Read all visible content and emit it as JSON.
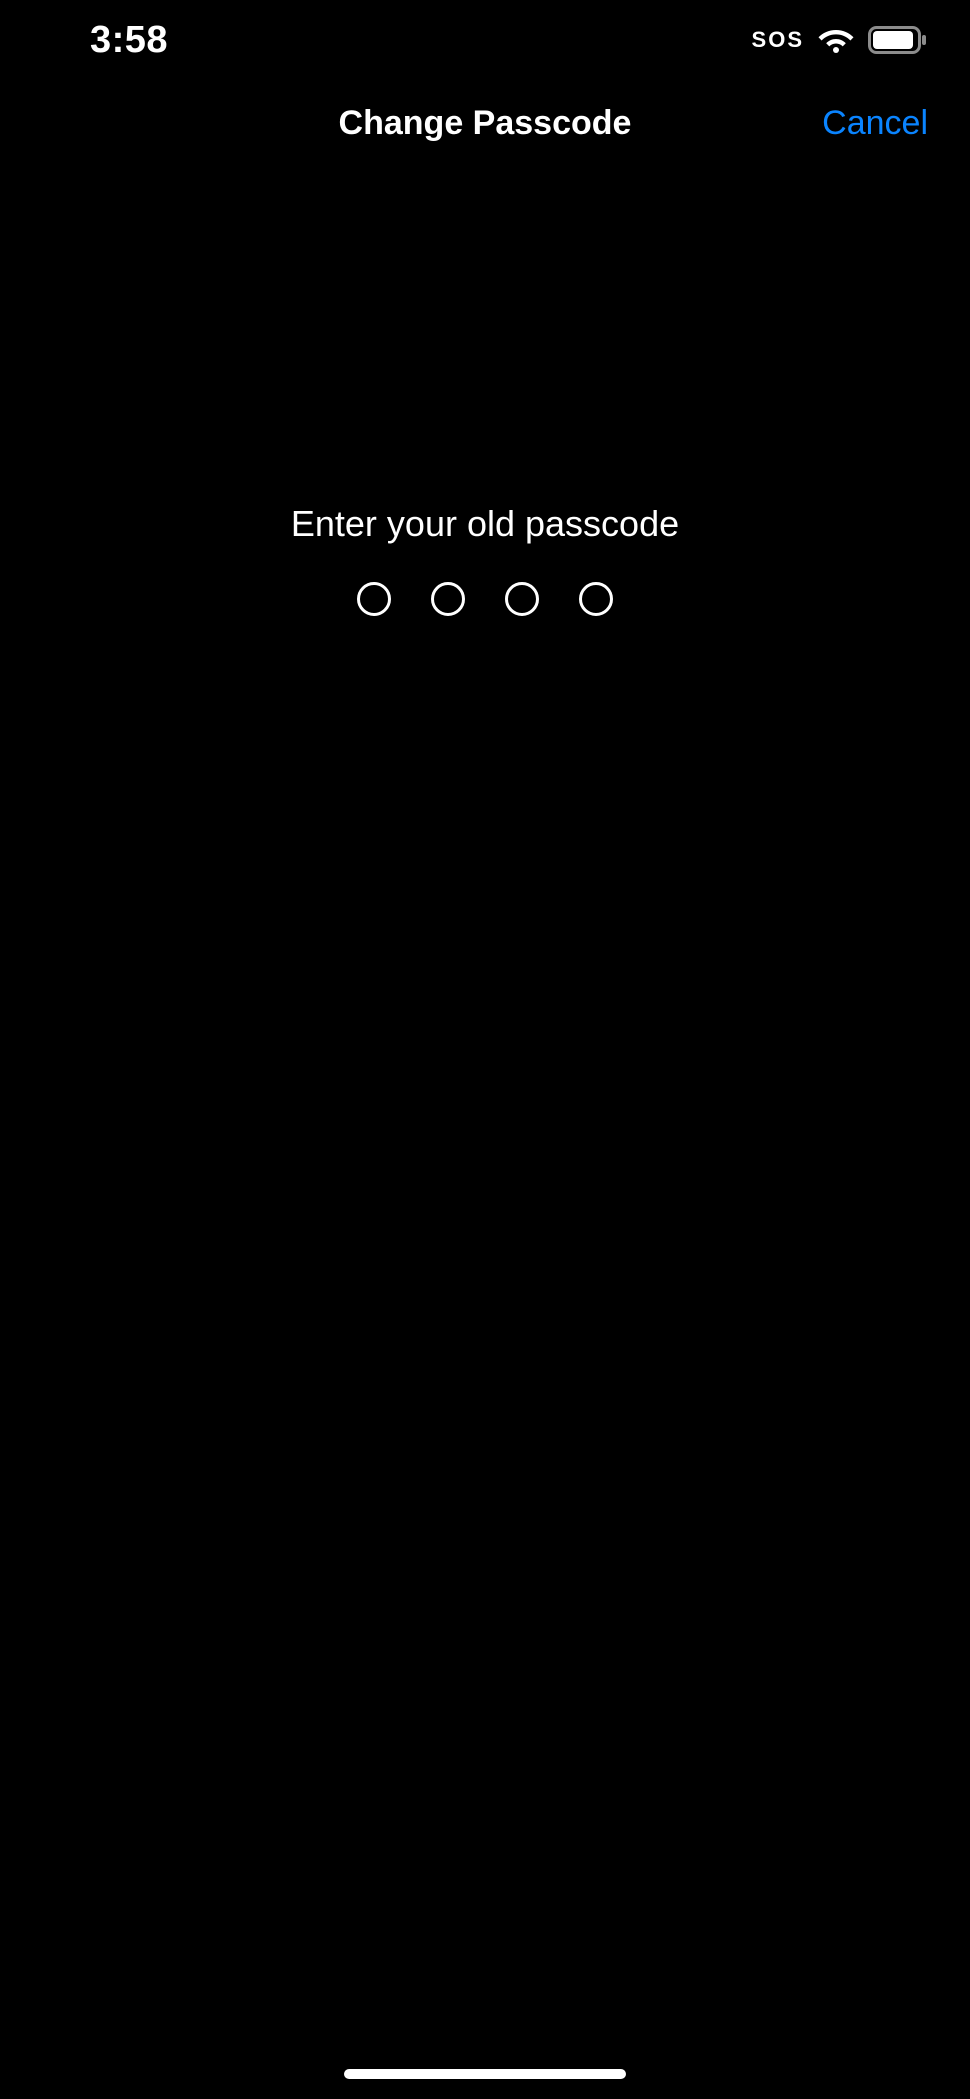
{
  "status_bar": {
    "time": "3:58",
    "sos": "SOS"
  },
  "nav": {
    "title": "Change Passcode",
    "cancel": "Cancel"
  },
  "main": {
    "prompt": "Enter your old passcode",
    "passcode_length": 4,
    "filled": 0
  }
}
